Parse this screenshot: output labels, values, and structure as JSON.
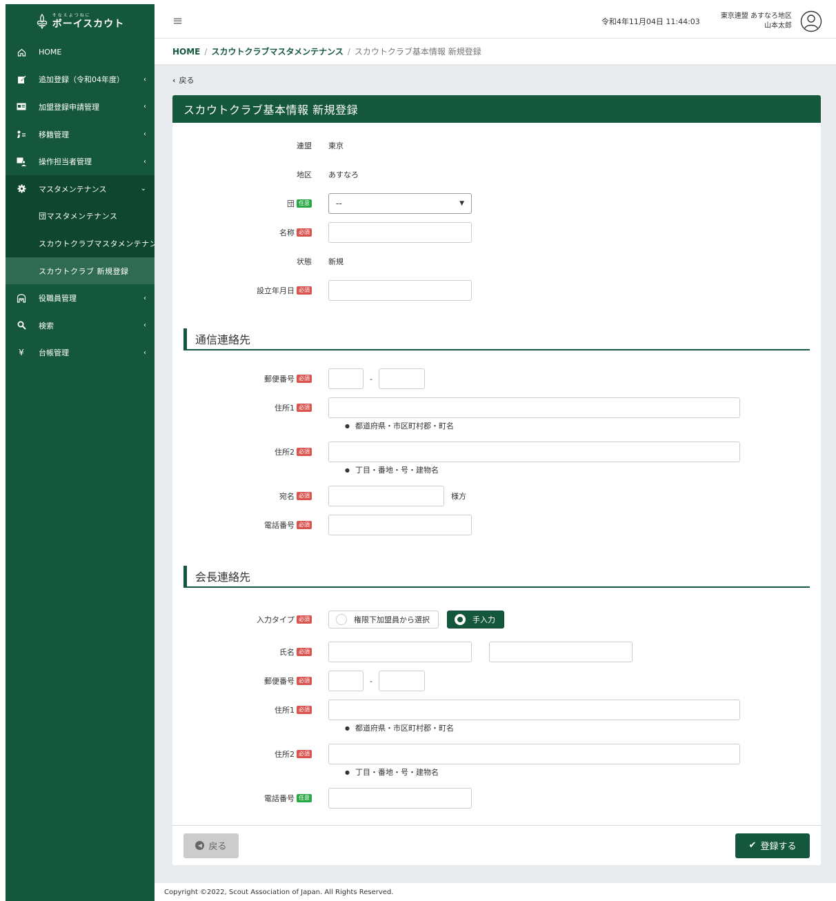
{
  "logo": {
    "sub": "そなえよつねに",
    "main": "ボーイスカウト"
  },
  "sidebar": {
    "items": [
      {
        "icon": "home-icon",
        "label": "HOME",
        "chevron": false
      },
      {
        "icon": "edit-icon",
        "label": "追加登録（令和04年度）",
        "chevron": true
      },
      {
        "icon": "id-card-icon",
        "label": "加盟登録申請管理",
        "chevron": true
      },
      {
        "icon": "transfer-icon",
        "label": "移籍管理",
        "chevron": true
      },
      {
        "icon": "operator-icon",
        "label": "操作担当者管理",
        "chevron": true
      },
      {
        "icon": "gear-icon",
        "label": "マスタメンテナンス",
        "chevron": true
      }
    ],
    "sub_items": [
      {
        "label": "団マスタメンテナンス"
      },
      {
        "label": "スカウトクラブマスタメンテナンス"
      },
      {
        "label": "スカウトクラブ 新規登録"
      }
    ],
    "items_after": [
      {
        "icon": "staff-icon",
        "label": "役職員管理"
      },
      {
        "icon": "search-icon",
        "label": "検索"
      },
      {
        "icon": "yen-icon",
        "label": "台帳管理"
      }
    ]
  },
  "topbar": {
    "datetime": "令和4年11月04日 11:44:03",
    "user_org": "東京連盟 あすなろ地区",
    "user_name": "山本太郎"
  },
  "breadcrumb": {
    "home": "HOME",
    "sep": "/",
    "parent": "スカウトクラブマスタメンテナンス",
    "current": "スカウトクラブ基本情報 新規登録"
  },
  "back_link": "戻る",
  "card": {
    "title": "スカウトクラブ基本情報 新規登録",
    "badges": {
      "required": "必須",
      "optional": "任意"
    },
    "basic": {
      "renmei_label": "連盟",
      "renmei_value": "東京",
      "chiku_label": "地区",
      "chiku_value": "あすなろ",
      "dan_label": "団",
      "dan_value": "--",
      "name_label": "名称",
      "status_label": "状態",
      "status_value": "新規",
      "established_label": "設立年月日"
    },
    "contact": {
      "section_title": "通信連絡先",
      "postal_label": "郵便番号",
      "postal_dash": "-",
      "address1_label": "住所1",
      "address1_note": "都道府県・市区町村郡・町名",
      "address2_label": "住所2",
      "address2_note": "丁目・番地・号・建物名",
      "addressee_label": "宛名",
      "addressee_suffix": "様方",
      "phone_label": "電話番号"
    },
    "president": {
      "section_title": "会長連絡先",
      "input_type_label": "入力タイプ",
      "radio_select": "権限下加盟員から選択",
      "radio_manual": "手入力",
      "name_label": "氏名",
      "postal_label": "郵便番号",
      "postal_dash": "-",
      "address1_label": "住所1",
      "address1_note": "都道府県・市区町村郡・町名",
      "address2_label": "住所2",
      "address2_note": "丁目・番地・号・建物名",
      "phone_label": "電話番号"
    },
    "footer": {
      "back": "戻る",
      "submit": "登録する"
    }
  },
  "copyright": "Copyright ©2022, Scout Association of Japan. All Rights Reserved."
}
